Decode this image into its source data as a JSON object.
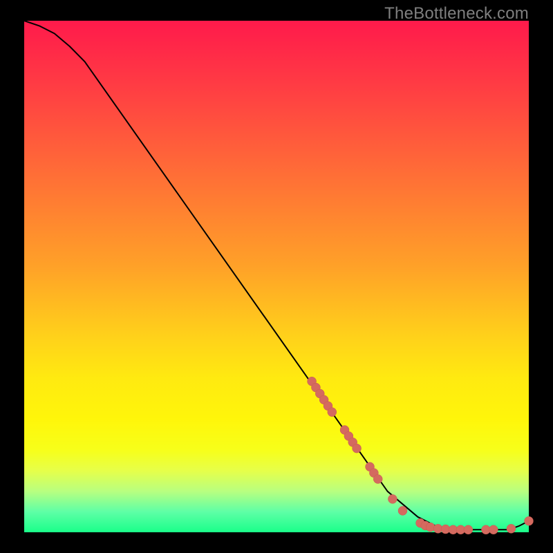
{
  "watermark": "TheBottleneck.com",
  "colors": {
    "background": "#000000",
    "curve": "#000000",
    "marker_fill": "#d46a5f",
    "marker_stroke": "#c85a50"
  },
  "chart_data": {
    "type": "line",
    "title": "",
    "xlabel": "",
    "ylabel": "",
    "xlim": [
      0,
      100
    ],
    "ylim": [
      0,
      100
    ],
    "grid": false,
    "legend": false,
    "curve_points": [
      {
        "x": 0,
        "y": 100
      },
      {
        "x": 3,
        "y": 99
      },
      {
        "x": 6,
        "y": 97.5
      },
      {
        "x": 9,
        "y": 95
      },
      {
        "x": 12,
        "y": 92
      },
      {
        "x": 72,
        "y": 8
      },
      {
        "x": 78,
        "y": 3
      },
      {
        "x": 82,
        "y": 1
      },
      {
        "x": 86,
        "y": 0.5
      },
      {
        "x": 96,
        "y": 0.5
      },
      {
        "x": 98,
        "y": 1.2
      },
      {
        "x": 100,
        "y": 2.2
      }
    ],
    "markers": [
      {
        "x": 57.0,
        "y": 29.5
      },
      {
        "x": 57.8,
        "y": 28.3
      },
      {
        "x": 58.6,
        "y": 27.1
      },
      {
        "x": 59.4,
        "y": 25.9
      },
      {
        "x": 60.2,
        "y": 24.7
      },
      {
        "x": 61.0,
        "y": 23.5
      },
      {
        "x": 63.5,
        "y": 20.0
      },
      {
        "x": 64.3,
        "y": 18.8
      },
      {
        "x": 65.1,
        "y": 17.6
      },
      {
        "x": 65.9,
        "y": 16.4
      },
      {
        "x": 68.5,
        "y": 12.8
      },
      {
        "x": 69.3,
        "y": 11.6
      },
      {
        "x": 70.1,
        "y": 10.4
      },
      {
        "x": 73.0,
        "y": 6.5
      },
      {
        "x": 75.0,
        "y": 4.2
      },
      {
        "x": 78.5,
        "y": 1.8
      },
      {
        "x": 79.5,
        "y": 1.3
      },
      {
        "x": 80.5,
        "y": 1.0
      },
      {
        "x": 82.0,
        "y": 0.7
      },
      {
        "x": 83.5,
        "y": 0.6
      },
      {
        "x": 85.0,
        "y": 0.5
      },
      {
        "x": 86.5,
        "y": 0.5
      },
      {
        "x": 88.0,
        "y": 0.5
      },
      {
        "x": 91.5,
        "y": 0.5
      },
      {
        "x": 93.0,
        "y": 0.5
      },
      {
        "x": 96.5,
        "y": 0.7
      },
      {
        "x": 100.0,
        "y": 2.2
      }
    ],
    "marker_radius_px": 6.5
  }
}
